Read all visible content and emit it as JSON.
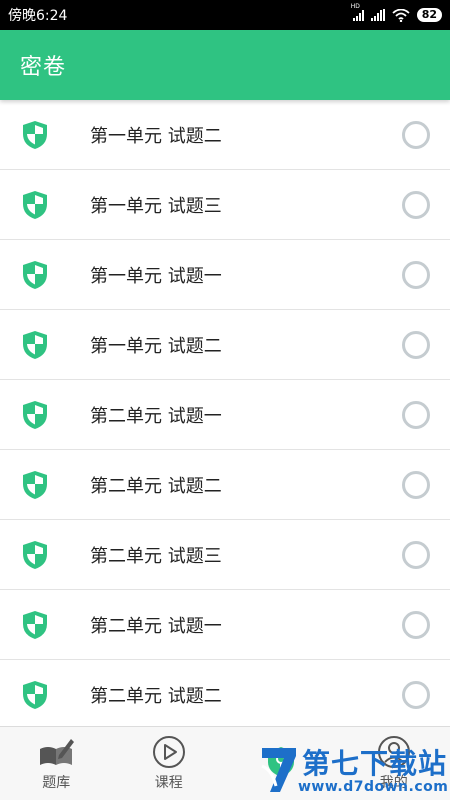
{
  "status_bar": {
    "time": "傍晚6:24",
    "hd_label": "HD",
    "battery": "82"
  },
  "app_bar": {
    "title": "密卷"
  },
  "list": [
    {
      "label": "第一单元 试题二"
    },
    {
      "label": "第一单元 试题三"
    },
    {
      "label": "第一单元 试题一"
    },
    {
      "label": "第一单元 试题二"
    },
    {
      "label": "第二单元 试题一"
    },
    {
      "label": "第二单元 试题二"
    },
    {
      "label": "第二单元 试题三"
    },
    {
      "label": "第二单元 试题一"
    },
    {
      "label": "第二单元 试题二"
    }
  ],
  "bottom_nav": [
    {
      "label": "题库",
      "icon": "book-pen-icon"
    },
    {
      "label": "课程",
      "icon": "play-circle-icon"
    },
    {
      "label": "",
      "icon": "shield-key-icon"
    },
    {
      "label": "我的",
      "icon": "user-icon"
    }
  ],
  "watermark": {
    "brand": "第七下载站",
    "url": "www.d7down.com",
    "logo_glyph": "7"
  },
  "colors": {
    "primary": "#2fc382",
    "shield": "#2fc382",
    "radio_border": "#c5ccd0",
    "watermark": "#1d6fc9"
  }
}
